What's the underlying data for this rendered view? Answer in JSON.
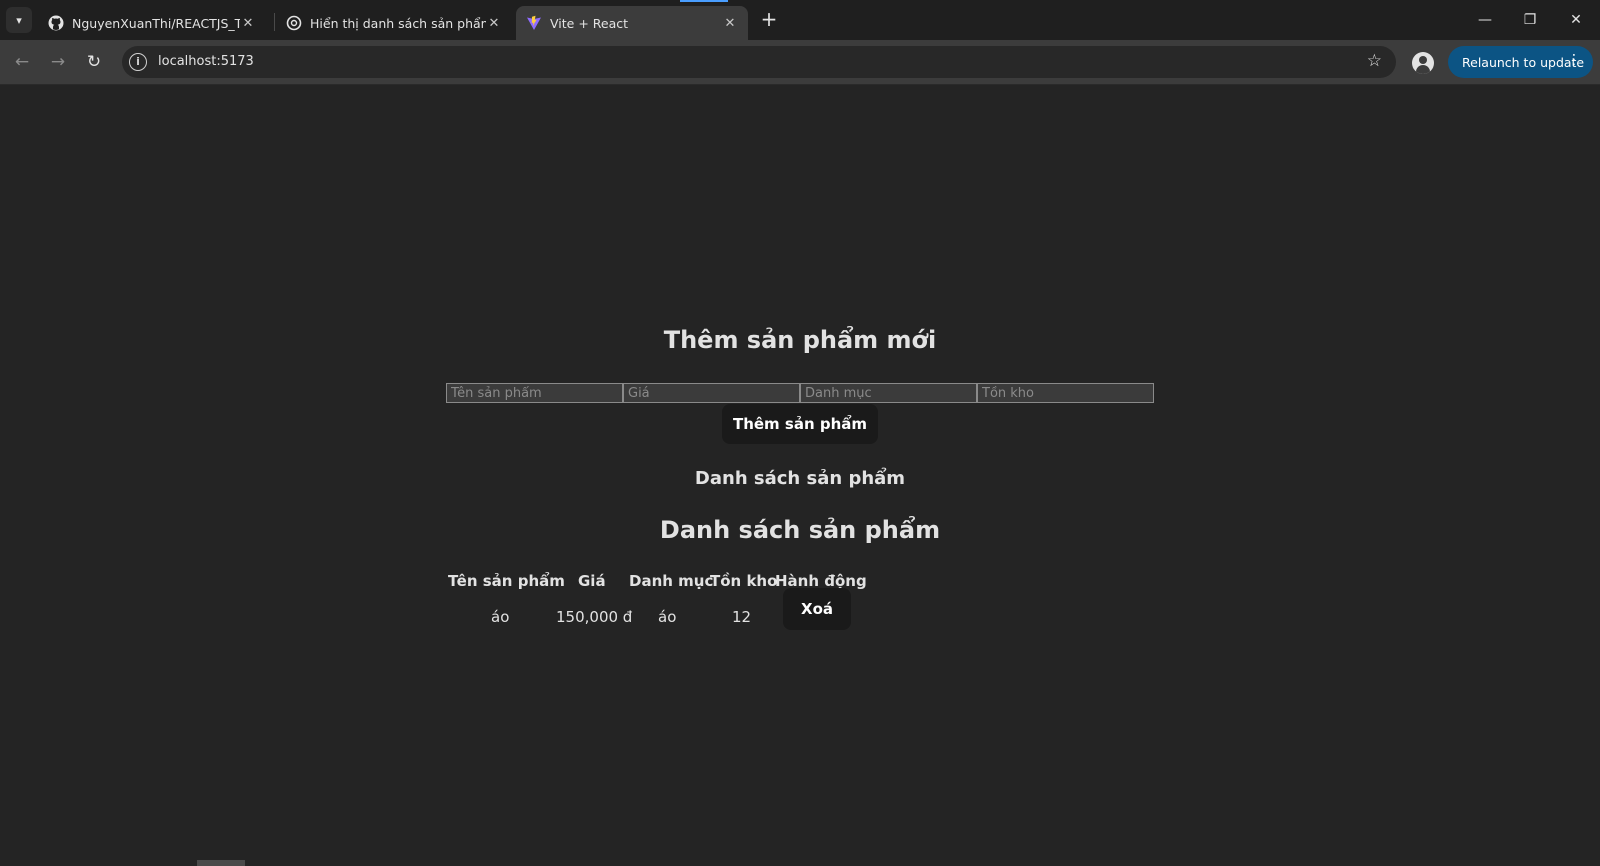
{
  "browser": {
    "tabs": [
      {
        "title": "NguyenXuanThi/REACTJS_Tuan",
        "icon": "github-icon",
        "active": false
      },
      {
        "title": "Hiển thị danh sách sản phẩm",
        "icon": "openai-icon",
        "active": false
      },
      {
        "title": "Vite + React",
        "icon": "vite-icon",
        "active": true
      }
    ],
    "url": "localhost:5173",
    "relaunch_label": "Relaunch to update",
    "accent_color": "#0c5484"
  },
  "form": {
    "title": "Thêm sản phẩm mới",
    "placeholders": {
      "name": "Tên sản phẩm",
      "price": "Giá",
      "category": "Danh mục",
      "stock": "Tồn kho"
    },
    "submit_label": "Thêm sản phẩm"
  },
  "list": {
    "subtitle": "Danh sách sản phẩm",
    "title": "Danh sách sản phẩm",
    "headers": {
      "name": "Tên sản phẩm",
      "price": "Giá",
      "category": "Danh mục",
      "stock": "Tồn kho",
      "action": "Hành động"
    },
    "rows": [
      {
        "name": "áo",
        "price": "150,000 đ",
        "category": "áo",
        "stock": "12",
        "delete_label": "Xoá"
      }
    ]
  }
}
